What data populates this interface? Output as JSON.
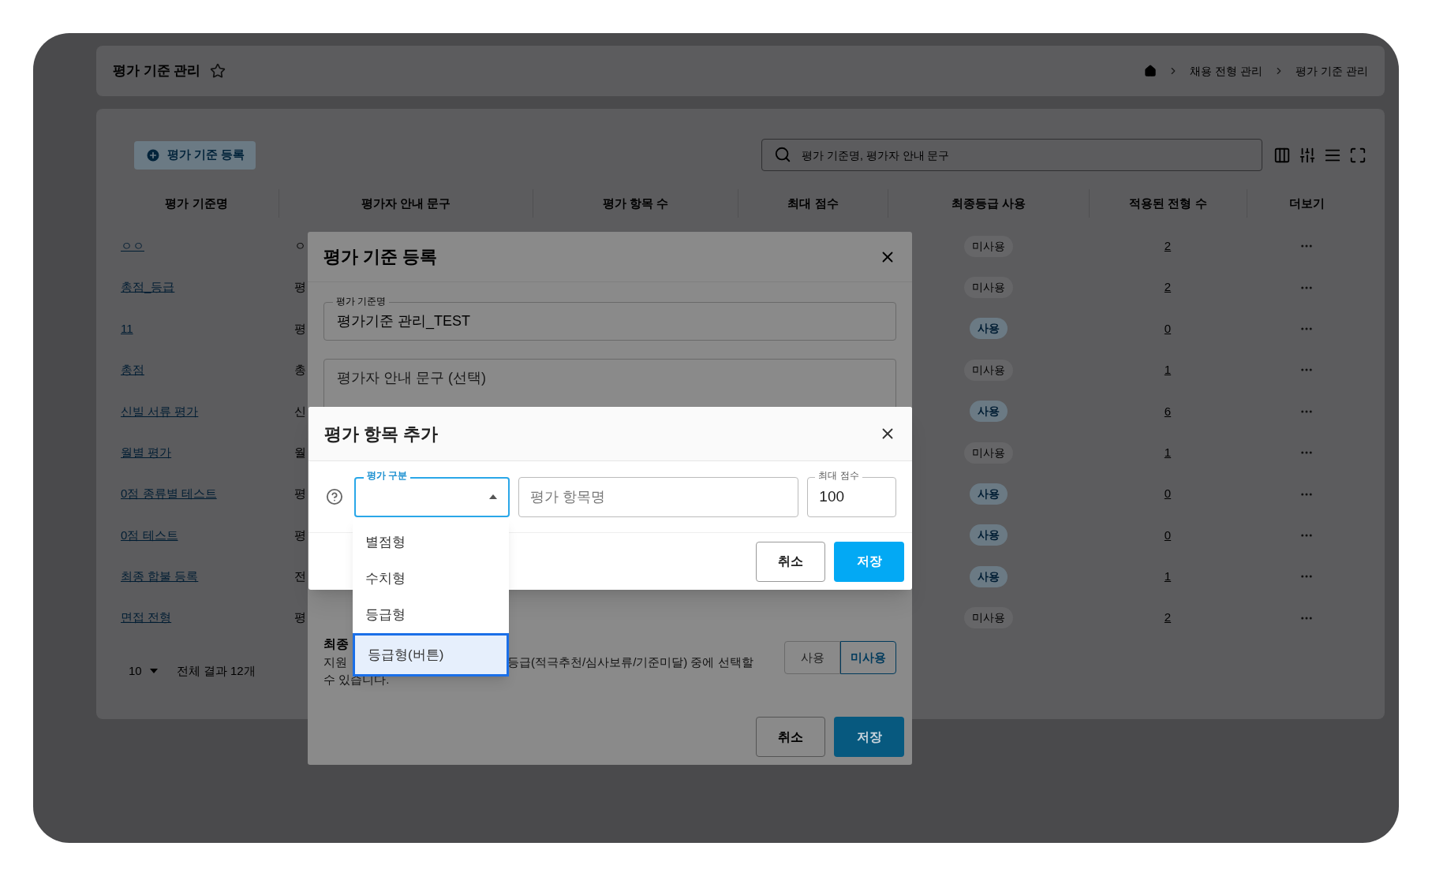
{
  "page_header": {
    "title": "평가 기준 관리",
    "breadcrumb": [
      "채용 전형 관리",
      "평가 기준 관리"
    ]
  },
  "toolbar": {
    "register_button": "평가 기준 등록",
    "search": {
      "placeholder": "평가 기준명, 평가자 안내 문구"
    }
  },
  "table": {
    "columns": [
      "평가 기준명",
      "평가자 안내 문구",
      "평가 항목 수",
      "최대 점수",
      "최종등급 사용",
      "적용된 전형 수",
      "더보기"
    ],
    "rows": [
      {
        "name": "ㅇㅇ",
        "guide": "ㅇ",
        "final_grade": "미사용",
        "final_grade_used": false,
        "count": "2"
      },
      {
        "name": "총점_등급",
        "guide": "평",
        "final_grade": "미사용",
        "final_grade_used": false,
        "count": "2"
      },
      {
        "name": "11",
        "guide": "평",
        "final_grade": "사용",
        "final_grade_used": true,
        "count": "0"
      },
      {
        "name": "총점",
        "guide": "총",
        "final_grade": "미사용",
        "final_grade_used": false,
        "count": "1"
      },
      {
        "name": "신빌 서류 평가",
        "guide": "신",
        "final_grade": "사용",
        "final_grade_used": true,
        "count": "6"
      },
      {
        "name": "월별 평가",
        "guide": "월",
        "final_grade": "미사용",
        "final_grade_used": false,
        "count": "1"
      },
      {
        "name": "0점 종류별 테스트",
        "guide": "평",
        "final_grade": "사용",
        "final_grade_used": true,
        "count": "0"
      },
      {
        "name": "0점 테스트",
        "guide": "평",
        "final_grade": "사용",
        "final_grade_used": true,
        "count": "0"
      },
      {
        "name": "최종 합불 등록",
        "guide": "전",
        "final_grade": "사용",
        "final_grade_used": true,
        "count": "1"
      },
      {
        "name": "면접 전형",
        "guide": "평",
        "final_grade": "미사용",
        "final_grade_used": false,
        "count": "2"
      }
    ]
  },
  "pagination": {
    "page_size": "10",
    "total": "전체 결과 12개"
  },
  "criteria_dialog": {
    "title": "평가 기준 등록",
    "name_field": {
      "label": "평가 기준명",
      "value": "평가기준 관리_TEST"
    },
    "guide_field": {
      "placeholder": "평가자 안내 문구 (선택)"
    },
    "final_grade": {
      "heading": "최종",
      "description_parts": [
        "지원",
        "등급(적극추천/심사보류/기준미달) 중에 선택할",
        "수 있습니다."
      ],
      "options": [
        {
          "label": "사용",
          "selected": false
        },
        {
          "label": "미사용",
          "selected": true
        }
      ]
    },
    "buttons": {
      "cancel": "취소",
      "save": "저장"
    }
  },
  "item_dialog": {
    "title": "평가 항목 추가",
    "type_select": {
      "label": "평가 구분",
      "expanded": true,
      "options": [
        {
          "label": "별점형",
          "selected": false
        },
        {
          "label": "수치형",
          "selected": false
        },
        {
          "label": "등급형",
          "selected": false
        },
        {
          "label": "등급형(버튼)",
          "selected": true
        }
      ]
    },
    "item_name": {
      "placeholder": "평가 항목명"
    },
    "max_score": {
      "label": "최대 점수",
      "value": "100"
    },
    "buttons": {
      "cancel": "취소",
      "save": "저장"
    }
  }
}
